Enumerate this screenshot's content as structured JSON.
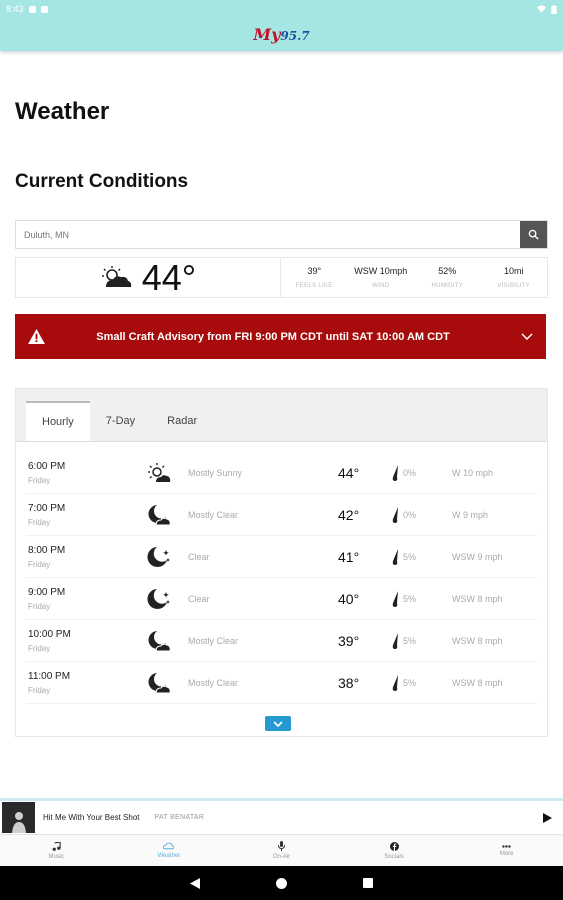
{
  "status_bar": {
    "time": "8:43"
  },
  "app": {
    "logo_my": "My",
    "logo_freq": "95.7",
    "brand_color": "#c3102a",
    "accent_color": "#a6e6e2"
  },
  "page_title": "Weather",
  "section_title": "Current Conditions",
  "search": {
    "value": "Duluth, MN",
    "icon": "search-icon"
  },
  "current": {
    "icon": "partly-cloudy-icon",
    "temp": "44°",
    "stats": [
      {
        "value": "39°",
        "label": "FEELS LIKE"
      },
      {
        "value": "WSW 10mph",
        "label": "WIND"
      },
      {
        "value": "52%",
        "label": "HUMIDITY"
      },
      {
        "value": "10mi",
        "label": "VISIBILITY"
      }
    ]
  },
  "alert": {
    "text": "Small Craft Advisory from FRI 9:00 PM CDT until SAT 10:00 AM CDT",
    "color": "#a80b0b"
  },
  "tabs": [
    {
      "label": "Hourly",
      "active": true
    },
    {
      "label": "7-Day",
      "active": false
    },
    {
      "label": "Radar",
      "active": false
    }
  ],
  "hourly": [
    {
      "time": "6:00 PM",
      "day": "Friday",
      "icon": "sun-cloud-icon",
      "condition": "Mostly Sunny",
      "temp": "44°",
      "precip": "0%",
      "wind": "W 10 mph"
    },
    {
      "time": "7:00 PM",
      "day": "Friday",
      "icon": "moon-cloud-icon",
      "condition": "Mostly Clear",
      "temp": "42°",
      "precip": "0%",
      "wind": "W 9 mph"
    },
    {
      "time": "8:00 PM",
      "day": "Friday",
      "icon": "moon-stars-icon",
      "condition": "Clear",
      "temp": "41°",
      "precip": "5%",
      "wind": "WSW 9 mph"
    },
    {
      "time": "9:00 PM",
      "day": "Friday",
      "icon": "moon-stars-icon",
      "condition": "Clear",
      "temp": "40°",
      "precip": "5%",
      "wind": "WSW 8 mph"
    },
    {
      "time": "10:00 PM",
      "day": "Friday",
      "icon": "moon-cloud-icon",
      "condition": "Mostly Clear",
      "temp": "39°",
      "precip": "5%",
      "wind": "WSW 8 mph"
    },
    {
      "time": "11:00 PM",
      "day": "Friday",
      "icon": "moon-cloud-icon",
      "condition": "Mostly Clear",
      "temp": "38°",
      "precip": "5%",
      "wind": "WSW 8 mph"
    }
  ],
  "player": {
    "song": "Hit Me With Your Best Shot",
    "artist": "PAT BENATAR"
  },
  "bottom_nav": [
    {
      "label": "Music",
      "icon": "music-note-icon",
      "active": false
    },
    {
      "label": "Weather",
      "icon": "cloud-icon",
      "active": true
    },
    {
      "label": "On-Air",
      "icon": "microphone-icon",
      "active": false
    },
    {
      "label": "Socials",
      "icon": "facebook-icon",
      "active": false
    },
    {
      "label": "More",
      "icon": "more-dots-icon",
      "active": false
    }
  ]
}
